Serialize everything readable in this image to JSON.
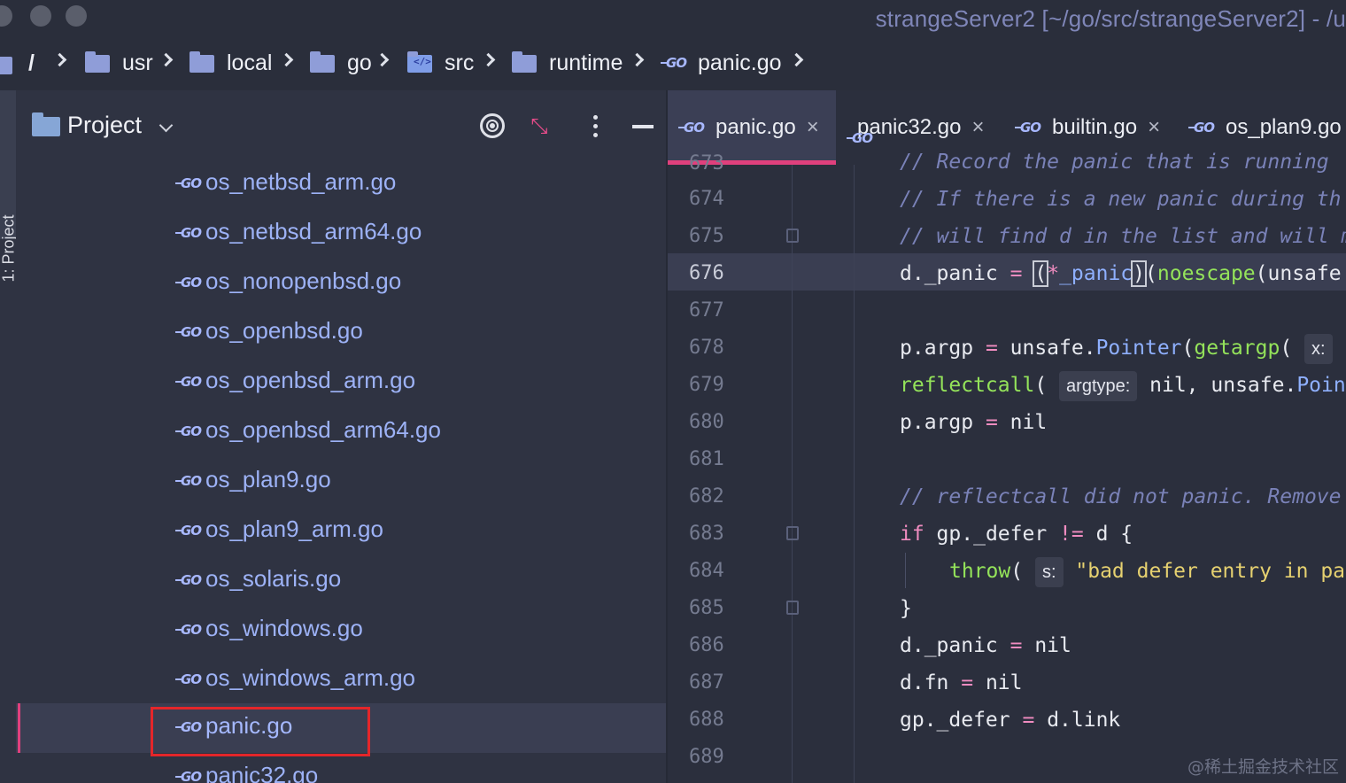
{
  "window": {
    "title": "strangeServer2 [~/go/src/strangeServer2] - /u"
  },
  "breadcrumb": [
    {
      "label": "/",
      "icon": "folder-icon"
    },
    {
      "label": "usr",
      "icon": "folder-icon"
    },
    {
      "label": "local",
      "icon": "folder-icon"
    },
    {
      "label": "go",
      "icon": "folder-icon"
    },
    {
      "label": "src",
      "icon": "source-folder-icon"
    },
    {
      "label": "runtime",
      "icon": "folder-icon"
    },
    {
      "label": "panic.go",
      "icon": "go-file-icon"
    }
  ],
  "toolstripe": {
    "label": "1: Project"
  },
  "project": {
    "title": "Project",
    "files": [
      "os_netbsd_arm.go",
      "os_netbsd_arm64.go",
      "os_nonopenbsd.go",
      "os_openbsd.go",
      "os_openbsd_arm.go",
      "os_openbsd_arm64.go",
      "os_plan9.go",
      "os_plan9_arm.go",
      "os_solaris.go",
      "os_windows.go",
      "os_windows_arm.go",
      "panic.go",
      "panic32.go"
    ],
    "selected": "panic.go"
  },
  "tabs": [
    {
      "label": "panic.go",
      "active": true
    },
    {
      "label": "panic32.go",
      "active": false
    },
    {
      "label": "builtin.go",
      "active": false
    },
    {
      "label": "os_plan9.go",
      "active": false
    }
  ],
  "editor": {
    "line_numbers": [
      "673",
      "674",
      "675",
      "676",
      "677",
      "678",
      "679",
      "680",
      "681",
      "682",
      "683",
      "684",
      "685",
      "686",
      "687",
      "688",
      "689"
    ],
    "current_line": "676",
    "code": {
      "l673": "// Record the panic that is running",
      "l674": "// If there is a new panic during th",
      "l675": "// will find d in the list and will m",
      "l678_hint": "x:",
      "l679_hint": "argtype:",
      "l682": "// reflectcall did not panic. Remove",
      "l684_hint": "s:",
      "l684_str": "\"bad defer entry in par"
    }
  },
  "colors": {
    "accent": "#e0407d",
    "highlight_box": "#e4262a"
  },
  "watermark": "@稀土掘金技术社区"
}
